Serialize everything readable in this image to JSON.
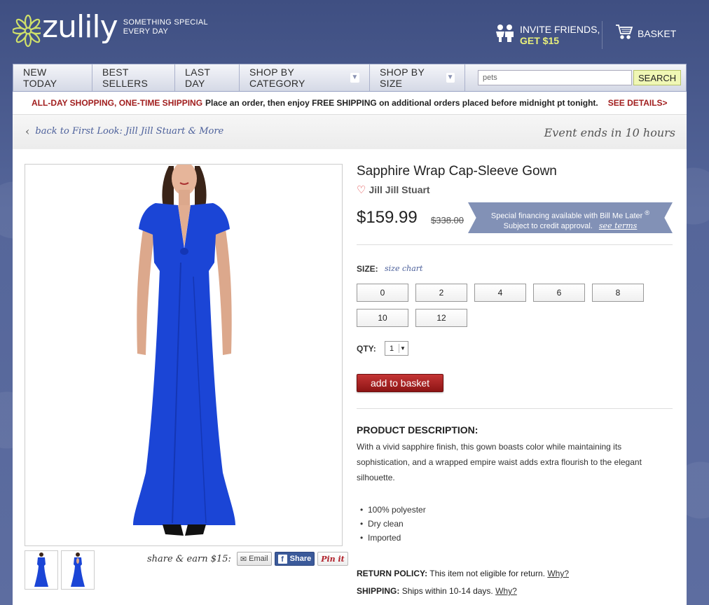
{
  "brand": {
    "logo_text": "zulily",
    "tagline_line1": "SOMETHING SPECIAL",
    "tagline_line2": "EVERY DAY"
  },
  "header": {
    "invite_line1": "INVITE FRIENDS,",
    "invite_line2": "GET $15",
    "basket_label": "BASKET"
  },
  "nav": {
    "items": [
      {
        "label": "NEW TODAY"
      },
      {
        "label": "BEST SELLERS"
      },
      {
        "label": "LAST DAY"
      },
      {
        "label": "SHOP BY CATEGORY"
      },
      {
        "label": "SHOP BY SIZE"
      }
    ],
    "search_value": "pets",
    "search_button": "SEARCH"
  },
  "promo": {
    "headline": "ALL-DAY SHOPPING, ONE-TIME SHIPPING",
    "text": "Place an order, then enjoy FREE SHIPPING on additional orders placed before midnight pt tonight.",
    "details_link": "SEE DETAILS>"
  },
  "breadcrumb": {
    "back_text": "back to First Look: Jill Jill Stuart & More",
    "event_ends": "Event ends in 10 hours"
  },
  "product": {
    "title": "Sapphire Wrap Cap-Sleeve Gown",
    "brand": "Jill Jill Stuart",
    "price": "$159.99",
    "original_price": "$338.00",
    "financing_line1": "Special financing available with Bill Me Later",
    "financing_mark": "®",
    "financing_line2": "Subject to credit approval.",
    "financing_link": "see terms",
    "size_label": "SIZE:",
    "size_chart": "size chart",
    "sizes": [
      "0",
      "2",
      "4",
      "6",
      "8",
      "10",
      "12"
    ],
    "qty_label": "QTY:",
    "qty_value": "1",
    "add_button": "add to basket",
    "desc_title": "PRODUCT DESCRIPTION:",
    "description": "With a vivid sapphire finish, this gown boasts color while maintaining its sophistication, and a wrapped empire waist adds extra flourish to the elegant silhouette.",
    "features": [
      "100% polyester",
      "Dry clean",
      "Imported"
    ],
    "return_label": "RETURN POLICY:",
    "return_text": "This item not eligible for return.",
    "shipping_label": "SHIPPING:",
    "shipping_text": "Ships within 10-14 days.",
    "why": "Why?"
  },
  "share": {
    "label": "share & earn $15:",
    "email": "Email",
    "facebook": "Share",
    "pinterest": "Pin it"
  },
  "colors": {
    "dress_blue": "#1b45d6",
    "accent_red": "#a11e1e",
    "link_blue": "#4b5f9a"
  }
}
